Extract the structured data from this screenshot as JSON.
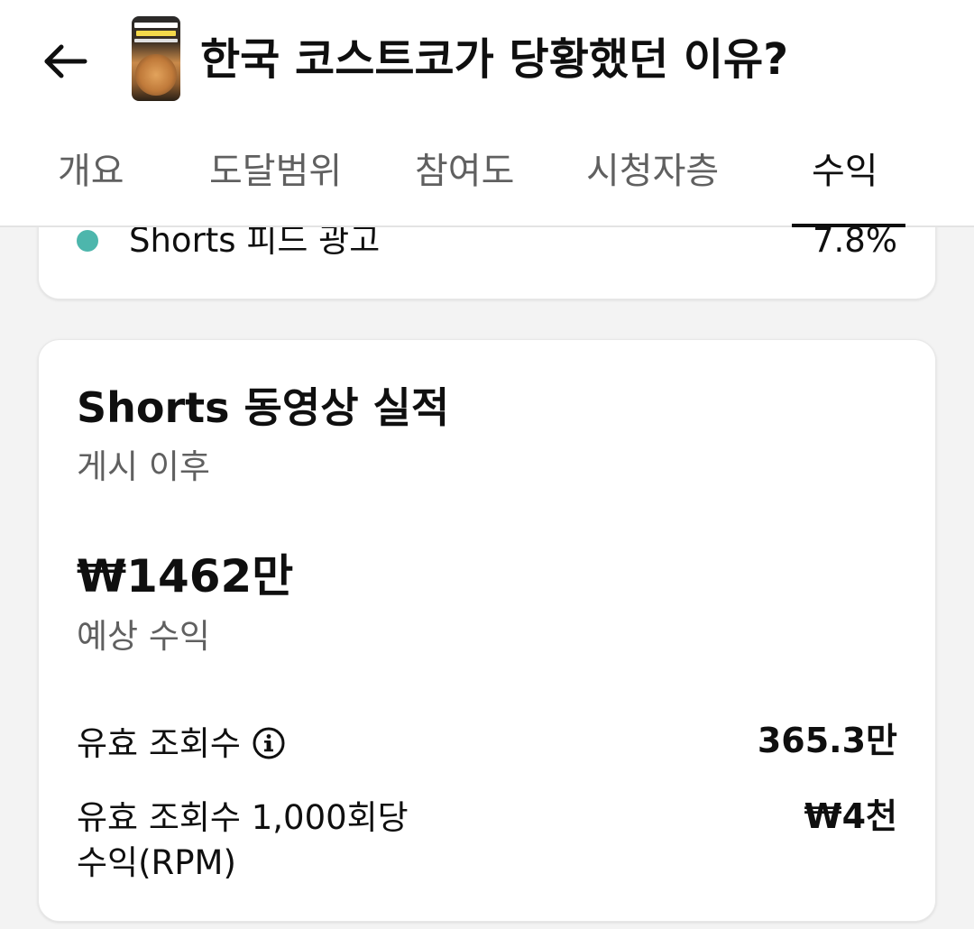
{
  "header": {
    "title": "한국 코스트코가 당황했던 이유?",
    "back_label": "뒤로",
    "thumbnail_caption": "한국 코스트코가 당황했던 이유"
  },
  "tabs": [
    {
      "label": "개요",
      "active": false
    },
    {
      "label": "도달범위",
      "active": false
    },
    {
      "label": "참여도",
      "active": false
    },
    {
      "label": "시청자층",
      "active": false
    },
    {
      "label": "수익",
      "active": true
    }
  ],
  "previous_card": {
    "legend_label": "Shorts 피드 광고",
    "legend_value": "7.8%",
    "legend_color": "#4db6ac"
  },
  "performance": {
    "title": "Shorts 동영상 실적",
    "subtitle": "게시 이후",
    "revenue_value": "₩1462만",
    "revenue_label": "예상 수익",
    "metrics": [
      {
        "label": "유효 조회수",
        "value": "365.3만",
        "has_info": true
      },
      {
        "label_line1": "유효 조회수 1,000회당",
        "label_line2": "수익(RPM)",
        "value": "₩4천"
      }
    ]
  },
  "colors": {
    "accent": "#0f0f0f",
    "secondary_text": "#606060",
    "background": "#f3f3f3",
    "card": "#ffffff"
  }
}
